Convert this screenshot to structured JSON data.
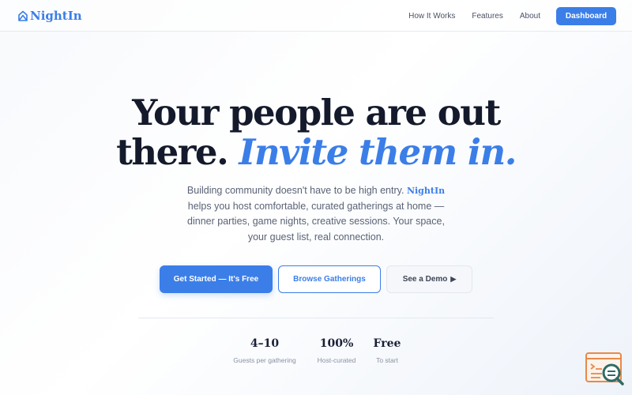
{
  "brand": {
    "name": "NightIn",
    "logo_icon": "house-icon",
    "accent_color": "#3b7ee8"
  },
  "nav": {
    "links": [
      "How It Works",
      "Features",
      "About"
    ],
    "dashboard_label": "Dashboard"
  },
  "hero": {
    "title_line1": "Your people are out",
    "title_line2_plain": "there.",
    "title_line2_accent": "Invite them in.",
    "desc_before": "Building community doesn't have to be high entry.",
    "desc_brand": "NightIn",
    "desc_after": "helps you host comfortable, curated gatherings at home — dinner parties, game nights, creative sessions. Your space, your guest list, real connection."
  },
  "cta": {
    "primary": "Get Started — It's Free",
    "secondary": "Browse Gatherings",
    "tertiary": "See a Demo",
    "tertiary_icon": "play-icon"
  },
  "stats": [
    {
      "value": "4–10",
      "label": "Guests per gathering"
    },
    {
      "value": "100%",
      "label": "Host-curated"
    },
    {
      "value": "Free",
      "label": "To start"
    }
  ],
  "widget": {
    "icon": "chat-search-icon"
  }
}
